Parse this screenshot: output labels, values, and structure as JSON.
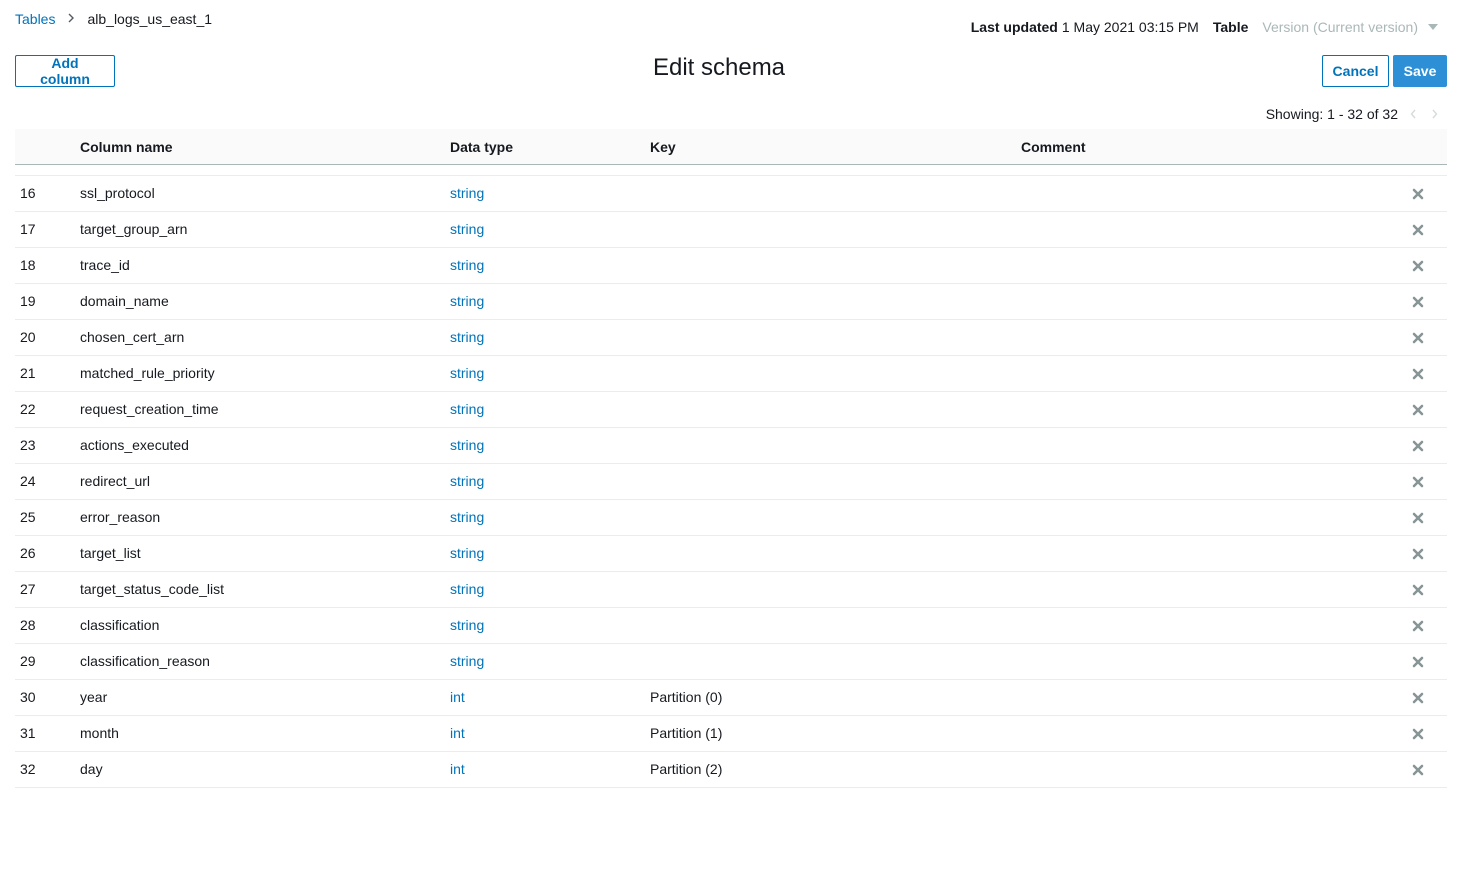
{
  "breadcrumb": {
    "parent": "Tables",
    "current": "alb_logs_us_east_1"
  },
  "meta": {
    "last_updated_label": "Last updated",
    "last_updated_value": "1 May 2021 03:15 PM",
    "table_label": "Table",
    "version_value": "Version (Current version)"
  },
  "toolbar": {
    "add_column": "Add column",
    "title": "Edit schema",
    "cancel": "Cancel",
    "save": "Save"
  },
  "pager": {
    "text": "Showing: 1 - 32 of 32"
  },
  "table": {
    "headers": {
      "name": "Column name",
      "type": "Data type",
      "key": "Key",
      "comment": "Comment"
    },
    "rows": [
      {
        "num": "16",
        "name": "ssl_protocol",
        "type": "string",
        "key": ""
      },
      {
        "num": "17",
        "name": "target_group_arn",
        "type": "string",
        "key": ""
      },
      {
        "num": "18",
        "name": "trace_id",
        "type": "string",
        "key": ""
      },
      {
        "num": "19",
        "name": "domain_name",
        "type": "string",
        "key": ""
      },
      {
        "num": "20",
        "name": "chosen_cert_arn",
        "type": "string",
        "key": ""
      },
      {
        "num": "21",
        "name": "matched_rule_priority",
        "type": "string",
        "key": ""
      },
      {
        "num": "22",
        "name": "request_creation_time",
        "type": "string",
        "key": ""
      },
      {
        "num": "23",
        "name": "actions_executed",
        "type": "string",
        "key": ""
      },
      {
        "num": "24",
        "name": "redirect_url",
        "type": "string",
        "key": ""
      },
      {
        "num": "25",
        "name": "error_reason",
        "type": "string",
        "key": ""
      },
      {
        "num": "26",
        "name": "target_list",
        "type": "string",
        "key": ""
      },
      {
        "num": "27",
        "name": "target_status_code_list",
        "type": "string",
        "key": ""
      },
      {
        "num": "28",
        "name": "classification",
        "type": "string",
        "key": ""
      },
      {
        "num": "29",
        "name": "classification_reason",
        "type": "string",
        "key": ""
      },
      {
        "num": "30",
        "name": "year",
        "type": "int",
        "key": "Partition (0)"
      },
      {
        "num": "31",
        "name": "month",
        "type": "int",
        "key": "Partition (1)"
      },
      {
        "num": "32",
        "name": "day",
        "type": "int",
        "key": "Partition (2)"
      }
    ]
  },
  "icons": {
    "delete": "close-icon",
    "breadcrumb_separator": "chevron-right-icon",
    "version_caret": "caret-down-icon",
    "pager_prev": "chevron-left-icon",
    "pager_next": "chevron-right-icon"
  },
  "colors": {
    "link": "#0073bb",
    "primary": "#2d8fd5",
    "disabled": "#aab7b8",
    "delete_icon": "#879596"
  }
}
